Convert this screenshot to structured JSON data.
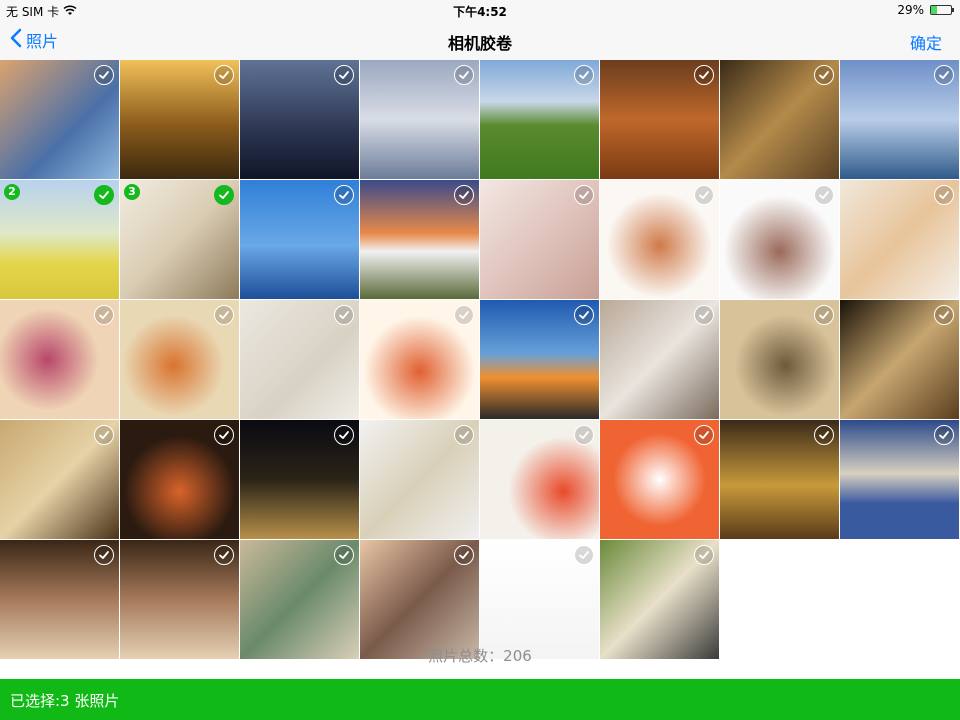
{
  "status_bar": {
    "carrier": "无 SIM 卡",
    "time": "下午4:52",
    "battery": "29%",
    "battery_level": 0.29,
    "wifi_icon": "wifi-icon"
  },
  "navbar": {
    "back_label": "照片",
    "title": "相机胶卷",
    "confirm_label": "确定"
  },
  "photos": [
    {
      "sel": false,
      "bg": "linear-gradient(135deg,#dba36f,#4a70a8 60%,#8fb8e0)"
    },
    {
      "sel": false,
      "bg": "linear-gradient(180deg,#f1c15a,#8a5a1a 55%,#3b2a10)"
    },
    {
      "sel": false,
      "bg": "linear-gradient(180deg,#5f7396,#2b3550 60%,#101528)"
    },
    {
      "sel": false,
      "bg": "linear-gradient(180deg,#9aa8c0,#d9dde6 50%,#6b7c99)"
    },
    {
      "sel": false,
      "bg": "linear-gradient(180deg,#7fa9d8,#c8d7e8 35%,#5b8a2f 55%,#3f7a1e)"
    },
    {
      "sel": false,
      "bg": "linear-gradient(180deg,#6b3d1e,#c0682b 50%,#7a3a12)"
    },
    {
      "sel": false,
      "bg": "linear-gradient(135deg,#3a2b18,#b48a4a 50%,#5a4224)"
    },
    {
      "sel": false,
      "bg": "linear-gradient(180deg,#6e8fc8,#b9cde8 50%,#2f5a8a)"
    },
    {
      "sel": true,
      "num": "2",
      "bg": "linear-gradient(180deg,#b8d2ee,#dfe8c7 45%,#e4d64b 70%,#d7c73a)"
    },
    {
      "sel": true,
      "num": "3",
      "bg": "linear-gradient(135deg,#f2ede0,#d9ccb3 50%,#8d7a5a)"
    },
    {
      "sel": false,
      "bg": "linear-gradient(180deg,#2f7fd8,#6aa8e6 55%,#1d4f99)"
    },
    {
      "sel": false,
      "bg": "linear-gradient(180deg,#3b4a8a,#e88a4a 45%,#f1f1f1 60%,#5a6a3a)"
    },
    {
      "sel": false,
      "bg": "linear-gradient(135deg,#f3e7e2,#e0c4bd 50%,#c79f95)"
    },
    {
      "sel": false,
      "bg": "radial-gradient(circle at 50% 55%,#cf7a4a,#fbf8f4 60%)"
    },
    {
      "sel": false,
      "bg": "radial-gradient(circle at 50% 60%,#9a6a5a,#fafafa 60%)"
    },
    {
      "sel": false,
      "bg": "linear-gradient(135deg,#f0e8dc,#e8c49a 50%,#f4efe8)"
    },
    {
      "sel": false,
      "bg": "radial-gradient(circle at 40% 50%,#b8466a,#efd4b5 55%)"
    },
    {
      "sel": false,
      "bg": "radial-gradient(circle at 45% 55%,#d9732f,#e9d8b4 55%)"
    },
    {
      "sel": false,
      "bg": "linear-gradient(135deg,#ece8e0,#d8d2c4 60%,#f1eee8)"
    },
    {
      "sel": false,
      "bg": "radial-gradient(circle at 50% 60%,#e06030,#fff6e9 60%)"
    },
    {
      "sel": false,
      "bg": "linear-gradient(180deg,#1f5ab1,#67a0d8 45%,#f09030 65%,#2a2a2a)"
    },
    {
      "sel": false,
      "bg": "linear-gradient(135deg,#b9a896,#e9e4de 50%,#7a6a5c)"
    },
    {
      "sel": false,
      "bg": "radial-gradient(circle at 55% 55%,#6b5a3a,#d8c29a 55%)"
    },
    {
      "sel": false,
      "bg": "linear-gradient(135deg,#1a1208,#c7a670 50%,#5a3e1e)"
    },
    {
      "sel": false,
      "bg": "linear-gradient(135deg,#c8a870,#e6d2a6 50%,#4a3218)"
    },
    {
      "sel": false,
      "bg": "radial-gradient(circle at 50% 60%,#d9642a,#2a1a10 60%)"
    },
    {
      "sel": false,
      "bg": "linear-gradient(180deg,#0a0a12,#2a2418 50%,#b8904a)"
    },
    {
      "sel": false,
      "bg": "linear-gradient(135deg,#f2f2f2,#d9d0b8 50%,#f0f0f0)"
    },
    {
      "sel": false,
      "bg": "radial-gradient(circle at 70% 60%,#e84a2a,#f4f0ea 50%)"
    },
    {
      "sel": false,
      "bg": "radial-gradient(circle at 50% 50%,#ffffff,#f06434 55%)"
    },
    {
      "sel": false,
      "bg": "linear-gradient(180deg,#3a2a1a,#c89a3a 55%,#5a3a1a)"
    },
    {
      "sel": false,
      "bg": "linear-gradient(180deg,#2c4a8a,#d8d0c0 45%,#3a5aa0 70%)"
    },
    {
      "sel": false,
      "bg": "linear-gradient(180deg,#3a2616,#a57a5a 50%,#e6d0b4)"
    },
    {
      "sel": false,
      "bg": "linear-gradient(180deg,#3a2616,#a57a5a 50%,#e6d0b4)"
    },
    {
      "sel": false,
      "bg": "linear-gradient(135deg,#c9b99a,#6a8a6a 50%,#d9cfb8)"
    },
    {
      "sel": false,
      "bg": "linear-gradient(135deg,#e9c6a6,#7a5a4a 50%,#c8b8a8)"
    },
    {
      "sel": false,
      "bg": "linear-gradient(180deg,#ffffff,#f4f4f4)"
    },
    {
      "sel": false,
      "bg": "linear-gradient(135deg,#6a8a3a,#e8e0c8 50%,#3a3a3a)"
    }
  ],
  "footer": {
    "total_label": "照片总数：206"
  },
  "bottom_bar": {
    "selected_label": "已选择:3 张照片"
  },
  "colors": {
    "accent": "#0a7aff",
    "selected_green": "#15b91e",
    "bottom_bar": "#10b916"
  }
}
